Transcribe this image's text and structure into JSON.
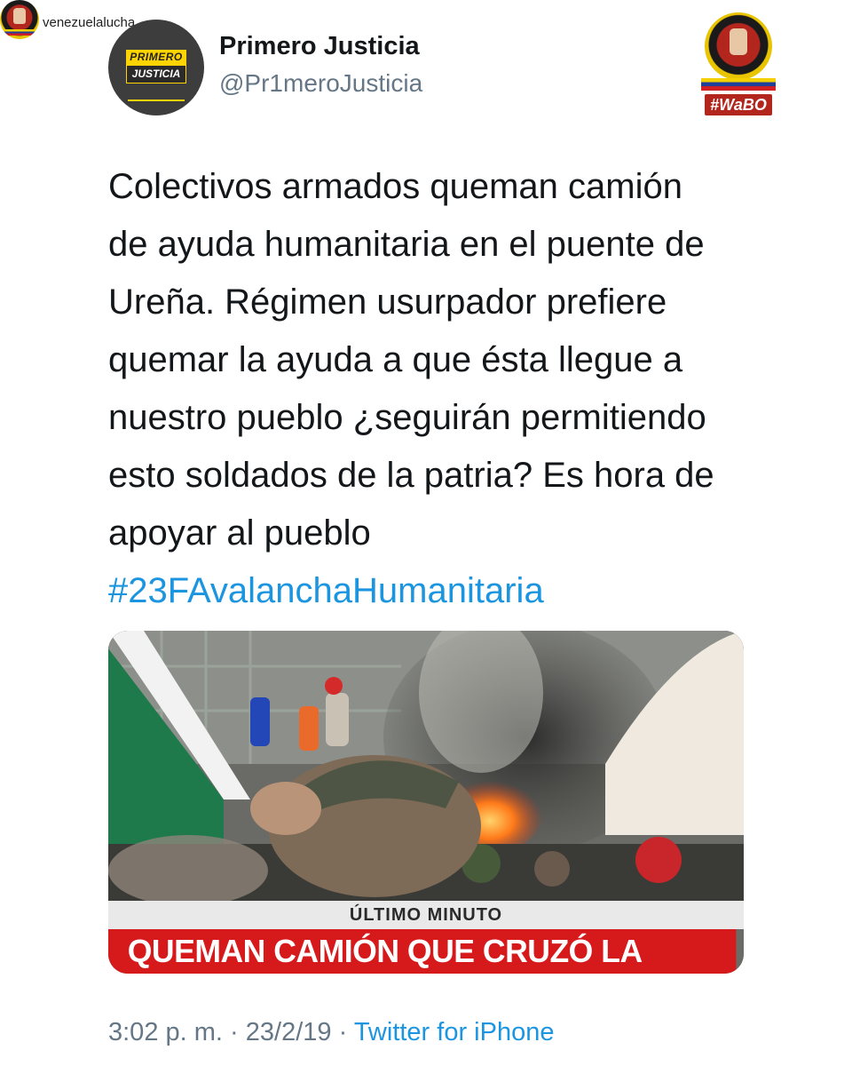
{
  "repost": {
    "username": "venezuelalucha"
  },
  "tweet": {
    "display_name": "Primero Justicia",
    "handle": "@Pr1meroJusticia",
    "avatar_logo_top": "PRIMERO",
    "avatar_logo_bottom": "JUSTICIA",
    "text": "Colectivos armados queman camión\nde ayuda humanitaria en el puente de\nUreña.  Régimen usurpador prefiere\nquemar la ayuda a que ésta llegue a\nnuestro pueblo ¿seguirán permitiendo\nesto soldados de la patria? Es hora de\napoyar al pueblo",
    "hashtag": "#23FAvalanchaHumanitaria",
    "time": "3:02 p. m.",
    "separator": "·",
    "date": "23/2/19",
    "source": "Twitter for iPhone"
  },
  "media": {
    "ticker_label": "ÚLTIMO MINUTO",
    "ticker_headline": "QUEMAN CAMIÓN QUE CRUZÓ LA FRONTERA"
  },
  "watermark": {
    "tag": "#WaBO"
  },
  "colors": {
    "link": "#1b95e0",
    "secondary_text": "#657786",
    "ticker_red": "#d6191b"
  }
}
